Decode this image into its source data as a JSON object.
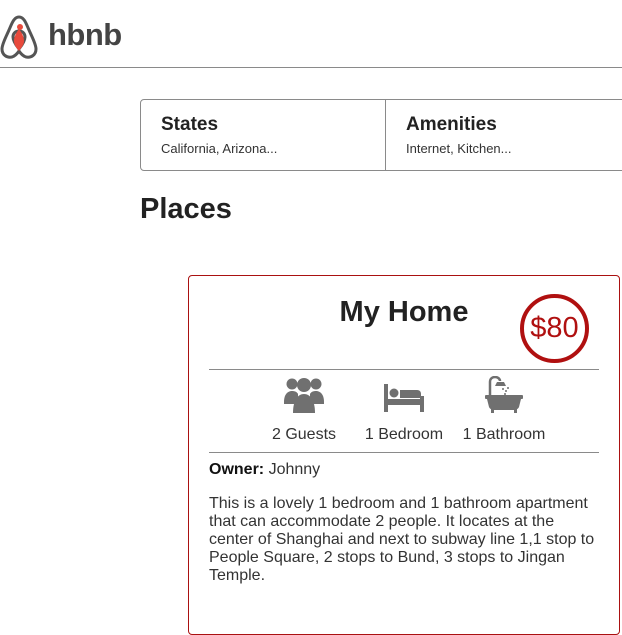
{
  "header": {
    "logo_text": "hbnb",
    "logo_icon": "airbnb-belo-icon"
  },
  "filters": [
    {
      "title": "States",
      "summary": "California, Arizona..."
    },
    {
      "title": "Amenities",
      "summary": "Internet, Kitchen..."
    }
  ],
  "places_title": "Places",
  "place": {
    "name": "My Home",
    "price": "$80",
    "info": [
      {
        "icon": "guests-icon",
        "label": "2 Guests"
      },
      {
        "icon": "bed-icon",
        "label": "1 Bedroom"
      },
      {
        "icon": "bathtub-icon",
        "label": "1 Bathroom"
      }
    ],
    "owner_label": "Owner:",
    "owner_name": "Johnny",
    "description": "This is a lovely 1 bedroom and 1 bathroom apartment that can accommodate 2 people. It locates at the center of Shanghai and next to subway line 1,1 stop to People Square, 2 stops to Bund, 3 stops to Jingan Temple."
  },
  "colors": {
    "brand": "#ff5a5f",
    "accent": "#b01010",
    "border": "#8a8a8a"
  }
}
